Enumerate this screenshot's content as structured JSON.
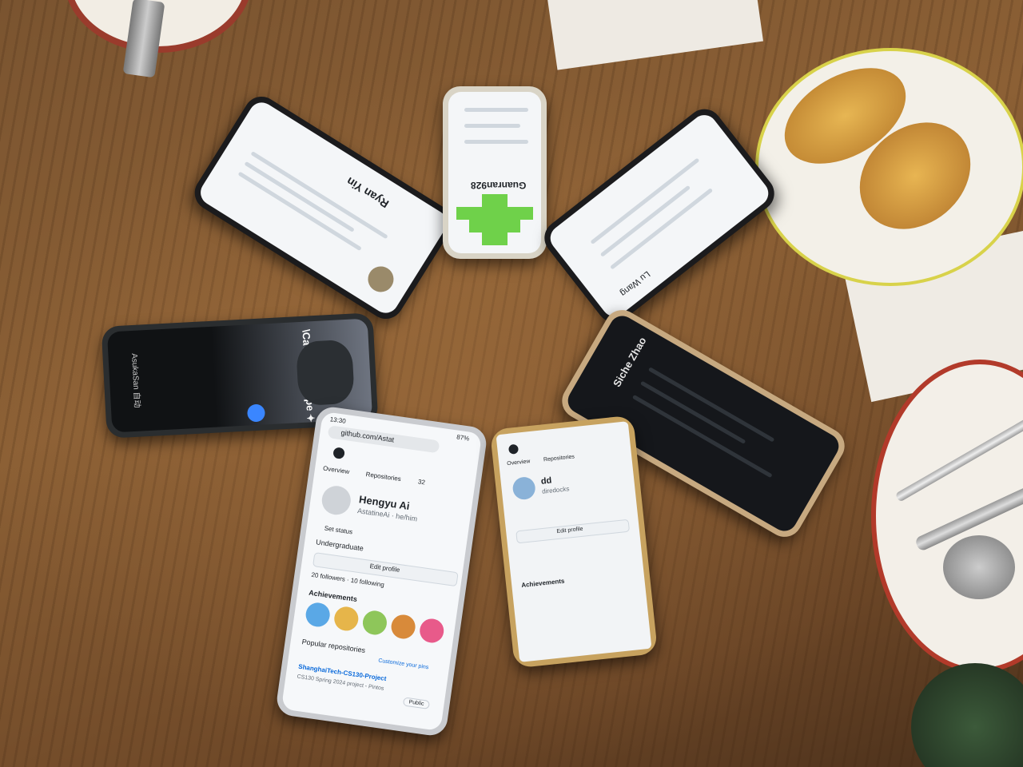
{
  "scene": {
    "phone_top_left": {
      "name": "Ryan Yin"
    },
    "phone_top_center": {
      "name": "Guanran928"
    },
    "phone_top_right": {
      "name": "Lu Wang"
    },
    "phone_left": {
      "title": "\\CaTaz ▷ escape ✦",
      "name": "AsukaSan 自动"
    },
    "phone_right": {
      "name": "Siche Zhao"
    },
    "phone_bottom_left": {
      "time": "13:30",
      "battery": "87%",
      "url": "github.com/Astat",
      "tab_overview": "Overview",
      "tab_repositories": "Repositories",
      "repo_count": "32",
      "name": "Hengyu Ai",
      "username": "AstatineAi · he/him",
      "set_status": "Set status",
      "bio": "Undergraduate",
      "edit_profile": "Edit profile",
      "followers_line": "20 followers · 10 following",
      "achievements": "Achievements",
      "popular_repos": "Popular repositories",
      "customize_pins": "Customize your pins",
      "repo_name": "ShanghaiTech-CS130-Project",
      "repo_desc": "CS130 Spring 2024 project - Pintos",
      "repo_visibility": "Public"
    },
    "phone_bottom_center": {
      "tab_overview": "Overview",
      "tab_repositories": "Repositories",
      "name": "dd",
      "username": "diredocks",
      "edit_profile": "Edit profile",
      "achievements": "Achievements"
    }
  },
  "colors": {
    "table": "#7a5430",
    "plate_rim": "#d8d24a",
    "plate_red_rim": "#b23a2a",
    "bread": "#d9a040",
    "github_link": "#0969da",
    "identicon_green": "#6fd14a"
  }
}
